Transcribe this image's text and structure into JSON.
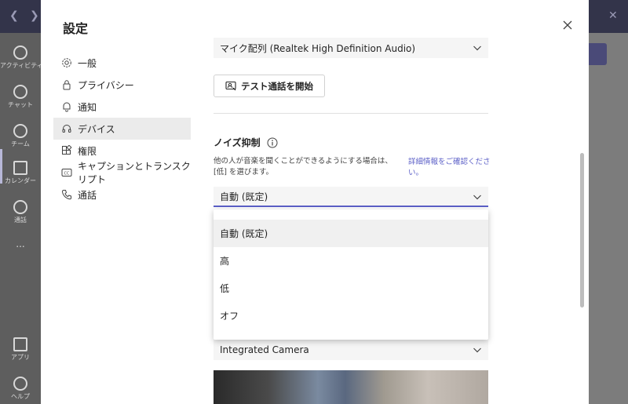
{
  "background": {
    "nav": [
      {
        "label": "アクティビティ",
        "icon": "bell-icon"
      },
      {
        "label": "チャット",
        "icon": "chat-icon"
      },
      {
        "label": "チーム",
        "icon": "teams-icon"
      },
      {
        "label": "カレンダー",
        "icon": "calendar-icon"
      },
      {
        "label": "通話",
        "icon": "phone-icon"
      },
      {
        "label": "...",
        "icon": "more-icon"
      },
      {
        "label": "アプリ",
        "icon": "apps-icon"
      },
      {
        "label": "ヘルプ",
        "icon": "help-icon"
      }
    ]
  },
  "dialog": {
    "title": "設定",
    "close_icon": "close-icon"
  },
  "nav": {
    "items": [
      {
        "label": "一般",
        "icon": "gear-icon",
        "active": false
      },
      {
        "label": "プライバシー",
        "icon": "lock-icon",
        "active": false
      },
      {
        "label": "通知",
        "icon": "bell-icon",
        "active": false
      },
      {
        "label": "デバイス",
        "icon": "headset-icon",
        "active": true
      },
      {
        "label": "権限",
        "icon": "apps-grid-icon",
        "active": false
      },
      {
        "label": "キャプションとトランスクリプト",
        "icon": "cc-icon",
        "active": false
      },
      {
        "label": "通話",
        "icon": "phone-icon",
        "active": false
      }
    ]
  },
  "devices": {
    "mic_value": "マイク配列 (Realtek High Definition Audio)",
    "test_call_label": "テスト通話を開始",
    "noise": {
      "heading": "ノイズ抑制",
      "description": "他の人が音楽を聞くことができるようにする場合は、[低] を選びます。",
      "link": "詳細情報をご確認ください。",
      "value": "自動 (既定)",
      "options": [
        "自動 (既定)",
        "高",
        "低",
        "オフ"
      ],
      "selected_index": 0
    },
    "camera_value": "Integrated Camera"
  },
  "colors": {
    "accent": "#5b5fc7",
    "topbar": "#33344a"
  }
}
